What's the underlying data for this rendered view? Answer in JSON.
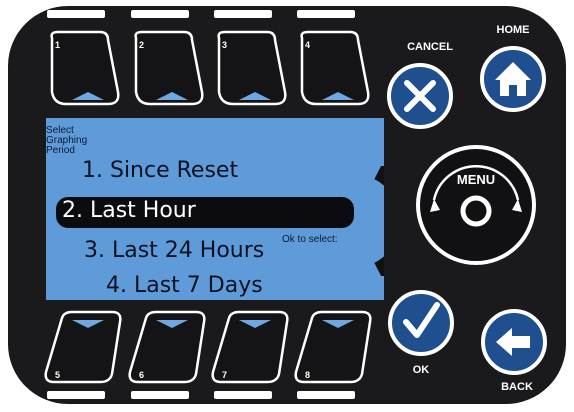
{
  "screen": {
    "prompt_lines": [
      "Select",
      "Graphing",
      "Period"
    ],
    "options": [
      {
        "label": "1. Since Reset"
      },
      {
        "label": "2. Last Hour",
        "selected": true
      },
      {
        "label": "3. Last 24 Hours"
      },
      {
        "label": "4. Last 7 Days"
      }
    ],
    "hint": "Ok to select:"
  },
  "buttons": {
    "cancel": "CANCEL",
    "home": "HOME",
    "menu": "MENU",
    "ok": "OK",
    "back": "BACK"
  },
  "softkeys_top": [
    "1",
    "2",
    "3",
    "4"
  ],
  "softkeys_bottom": [
    "5",
    "6",
    "7",
    "8"
  ],
  "colors": {
    "panel": "#1a1a1c",
    "screen": "#5f9bd9",
    "button_blue": "#1f4f8f",
    "accent": "#6fa7e3"
  },
  "icons": {
    "cancel": "x-icon",
    "home": "house-icon",
    "ok": "checkmark-icon",
    "back": "left-arrow-icon",
    "menu": "circle-icon"
  }
}
